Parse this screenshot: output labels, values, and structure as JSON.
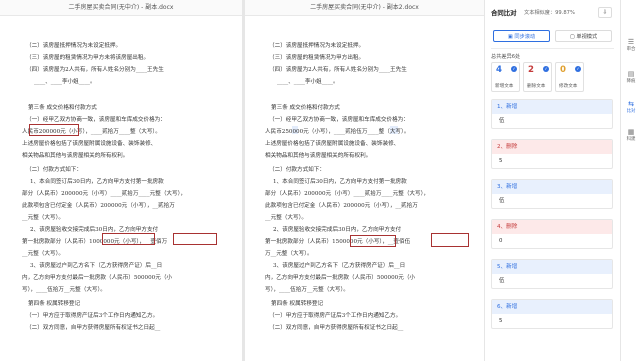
{
  "left_doc": {
    "title": "二手房屋买卖合同(无中介) - 副本.docx",
    "lines": [
      "（二）该房屋抵押情况为未设定抵押。",
      "（三）该房屋的租赁情况为甲方未将该房屋出租。",
      "（四）该房屋为2人共有，所有人姓名分别为____王先生",
      "____、____李小姐____。",
      "第三条  成交价格和付款方式",
      "（一）经甲乙双方协商一致，该房屋和车库成交价格为：",
      "人民币200000元（小写），____贰拾万____整（大写）。",
      "上述房屋价格包括了该房屋附属设施设备、装饰装修、",
      "相关物品和其他与该房屋相关的所有权利。",
      "（二）付款方式如下：",
      "1、本合同签订后30日内，乙方向甲方支付第一批房款",
      "部分（人民币）200000元（小写）____贰拾万____元整（大写），",
      "此款项包含已付定金（人民币）200000元（小写），__贰拾万",
      "__元整（大写）。",
      "2、该房屋验收交接完成后30日内，乙方向甲方支付",
      "第一批房款部分（人民币）1000000元（小写），__壹佰万",
      "__元整（大写）。",
      "3、该房屋过户到乙方名下（乙方获得房产证）后__日",
      "内，乙方向甲方支付最后一批房款（人民币）500000元（小",
      "写），____伍拾万__元整（大写）。",
      "第四条  权属转移登记",
      "（一）甲方应于取得房产证后3个工作日内通知乙方。",
      "（二）双方同意，自甲方获得房屋所有权证书之日起__"
    ]
  },
  "right_doc": {
    "title": "二手房屋买卖合同(无中介) - 副本2.docx",
    "lines": [
      "（二）该房屋抵押情况为未设定抵押。",
      "（三）该房屋的租赁情况为甲方出租。",
      "（四）该房屋为2人共有，所有人姓名分别为____王先生",
      "____、____李小姐____。",
      "第三条  成交价格和付款方式",
      "（一）经甲乙双方协商一致，该房屋和车库成交价格为：",
      "人民币250000元（小写），____贰拾伍万____整（大写）。",
      "上述房屋价格包括了该房屋附属设施设备、装饰装修、",
      "相关物品和其他与该房屋相关的所有权利。",
      "（二）付款方式如下：",
      "1、本合同签订后30日内，乙方向甲方支付第一批房款",
      "部分（人民币）200000元（小写）____贰拾万____元整（大写），",
      "此款项包含已付定金（人民币）200000元（小写），__贰拾万",
      "__元整（大写）。",
      "2、该房屋验收交接完成后30日内，乙方向甲方支付",
      "第一批房款部分（人民币）1500000元（小写），__壹佰伍",
      "万__元整（大写）。",
      "3、该房屋过户到乙方名下（乙方获得房产证）后__日",
      "内，乙方向甲方支付最后一批房款（人民币）500000元（小",
      "写），____伍拾万__元整（大写）。",
      "第四条  权属转移登记",
      "（一）甲方应于取得房产证后3个工作日内通知乙方。",
      "（二）双方同意，自甲方获得房屋所有权证书之日起__"
    ]
  },
  "panel": {
    "title": "合同比对",
    "similarity": "文本相似度：99.87%",
    "export": "⇩",
    "sync_scroll": "同步滚动",
    "single_mode": "单视模式",
    "diff_count": "总共差异6处",
    "stats": [
      {
        "num": "4",
        "label": "新增文本",
        "color": "#2f6fe0"
      },
      {
        "num": "2",
        "label": "删除文本",
        "color": "#c43b3b"
      },
      {
        "num": "0",
        "label": "修改文本",
        "color": "#e0a02f"
      }
    ],
    "cards": [
      {
        "head": "1、新增",
        "body": "伍",
        "kind": "add"
      },
      {
        "head": "2、删除",
        "body": "5",
        "kind": "del"
      },
      {
        "head": "3、新增",
        "body": "伍",
        "kind": "add"
      },
      {
        "head": "4、删除",
        "body": "0",
        "kind": "del"
      },
      {
        "head": "5、新增",
        "body": "伍",
        "kind": "add"
      },
      {
        "head": "6、新增",
        "body": "5",
        "kind": "add"
      }
    ]
  },
  "rail": [
    {
      "icon": "☰",
      "label": "审合"
    },
    {
      "icon": "▤",
      "label": "降痕"
    },
    {
      "icon": "⇆",
      "label": "比对",
      "active": true
    },
    {
      "icon": "▦",
      "label": "科建"
    }
  ]
}
